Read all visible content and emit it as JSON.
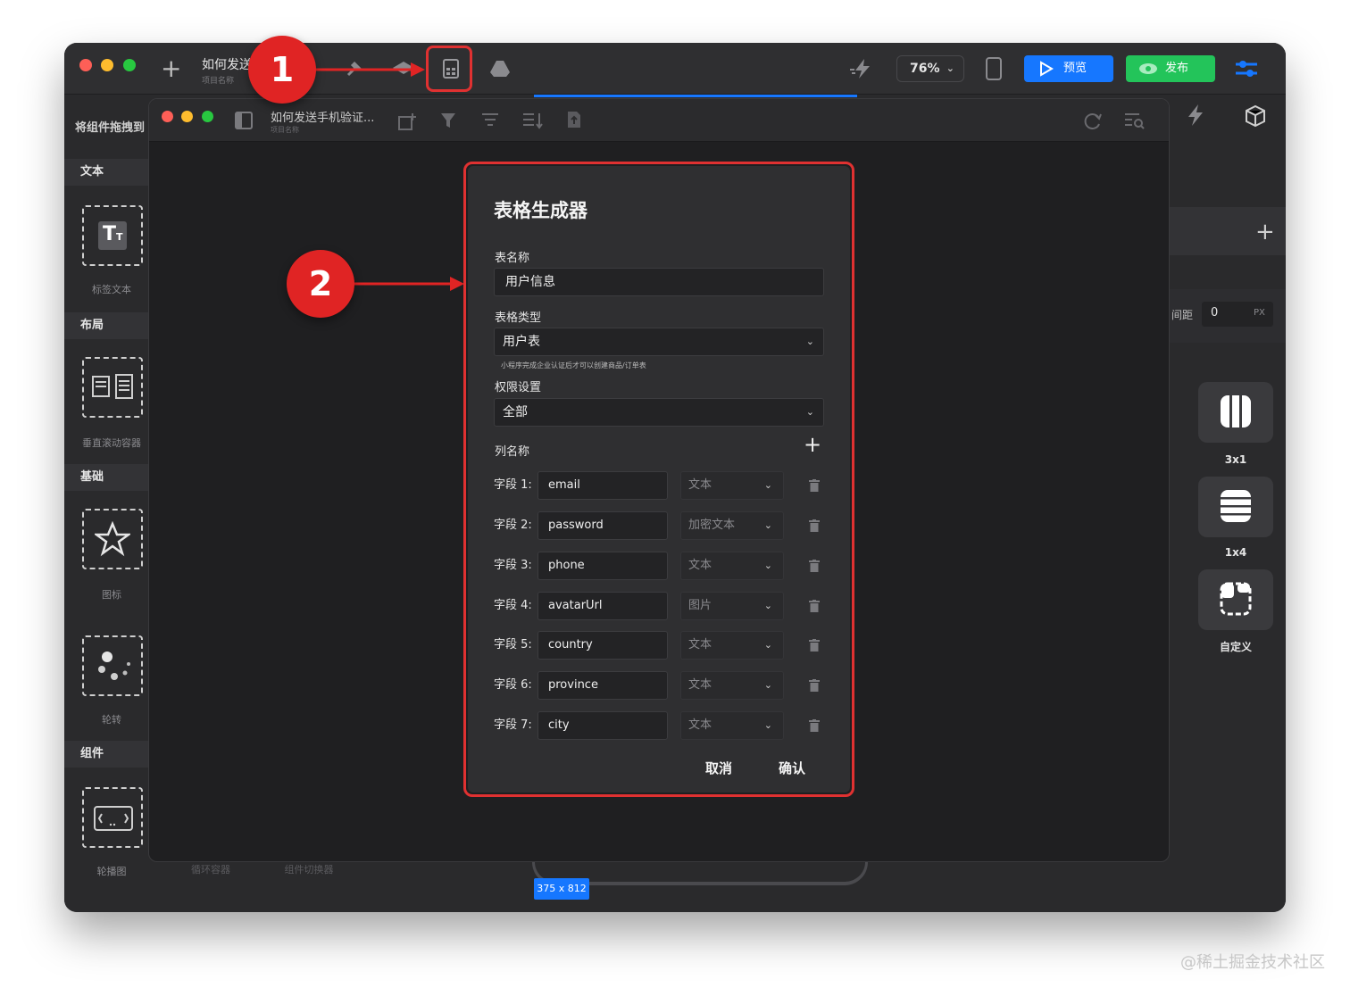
{
  "outer": {
    "project_title": "如何发送",
    "project_sub": "项目名称",
    "zoom": "76%",
    "preview_label": "预览",
    "publish_label": "发布"
  },
  "sidebar": {
    "header": "将组件拖拽到",
    "sections": [
      {
        "title": "文本",
        "item": "标签文本"
      },
      {
        "title": "布局",
        "item": "垂直滚动容器"
      },
      {
        "title": "基础",
        "item": "图标"
      },
      {
        "title": "",
        "item": "轮转"
      },
      {
        "title": "组件",
        "item": "轮播图"
      }
    ],
    "bottom_tabs": [
      "循环容器",
      "组件切换器"
    ]
  },
  "right_panel": {
    "spacing_label": "间距",
    "spacing_value": "0",
    "spacing_unit": "PX",
    "layouts": [
      "3x1",
      "1x4",
      "自定义"
    ]
  },
  "inner": {
    "project_title": "如何发送手机验证...",
    "project_sub": "项目名称"
  },
  "dialog": {
    "title": "表格生成器",
    "table_name_label": "表名称",
    "table_name_value": "用户信息",
    "table_type_label": "表格类型",
    "table_type_value": "用户表",
    "table_type_hint": "小程序完成企业认证后才可以创建商品/订单表",
    "permission_label": "权限设置",
    "permission_value": "全部",
    "columns_label": "列名称",
    "fields": [
      {
        "label": "字段 1:",
        "name": "email",
        "type": "文本"
      },
      {
        "label": "字段 2:",
        "name": "password",
        "type": "加密文本"
      },
      {
        "label": "字段 3:",
        "name": "phone",
        "type": "文本"
      },
      {
        "label": "字段 4:",
        "name": "avatarUrl",
        "type": "图片"
      },
      {
        "label": "字段 5:",
        "name": "country",
        "type": "文本"
      },
      {
        "label": "字段 6:",
        "name": "province",
        "type": "文本"
      },
      {
        "label": "字段 7:",
        "name": "city",
        "type": "文本"
      }
    ],
    "cancel_label": "取消",
    "confirm_label": "确认"
  },
  "callouts": [
    "1",
    "2"
  ],
  "canvas_size": "375 x 812",
  "watermark": "@稀土掘金技术社区",
  "colors": {
    "accent_red": "#e02424",
    "preview_blue": "#1677ff",
    "publish_green": "#23c45a"
  }
}
